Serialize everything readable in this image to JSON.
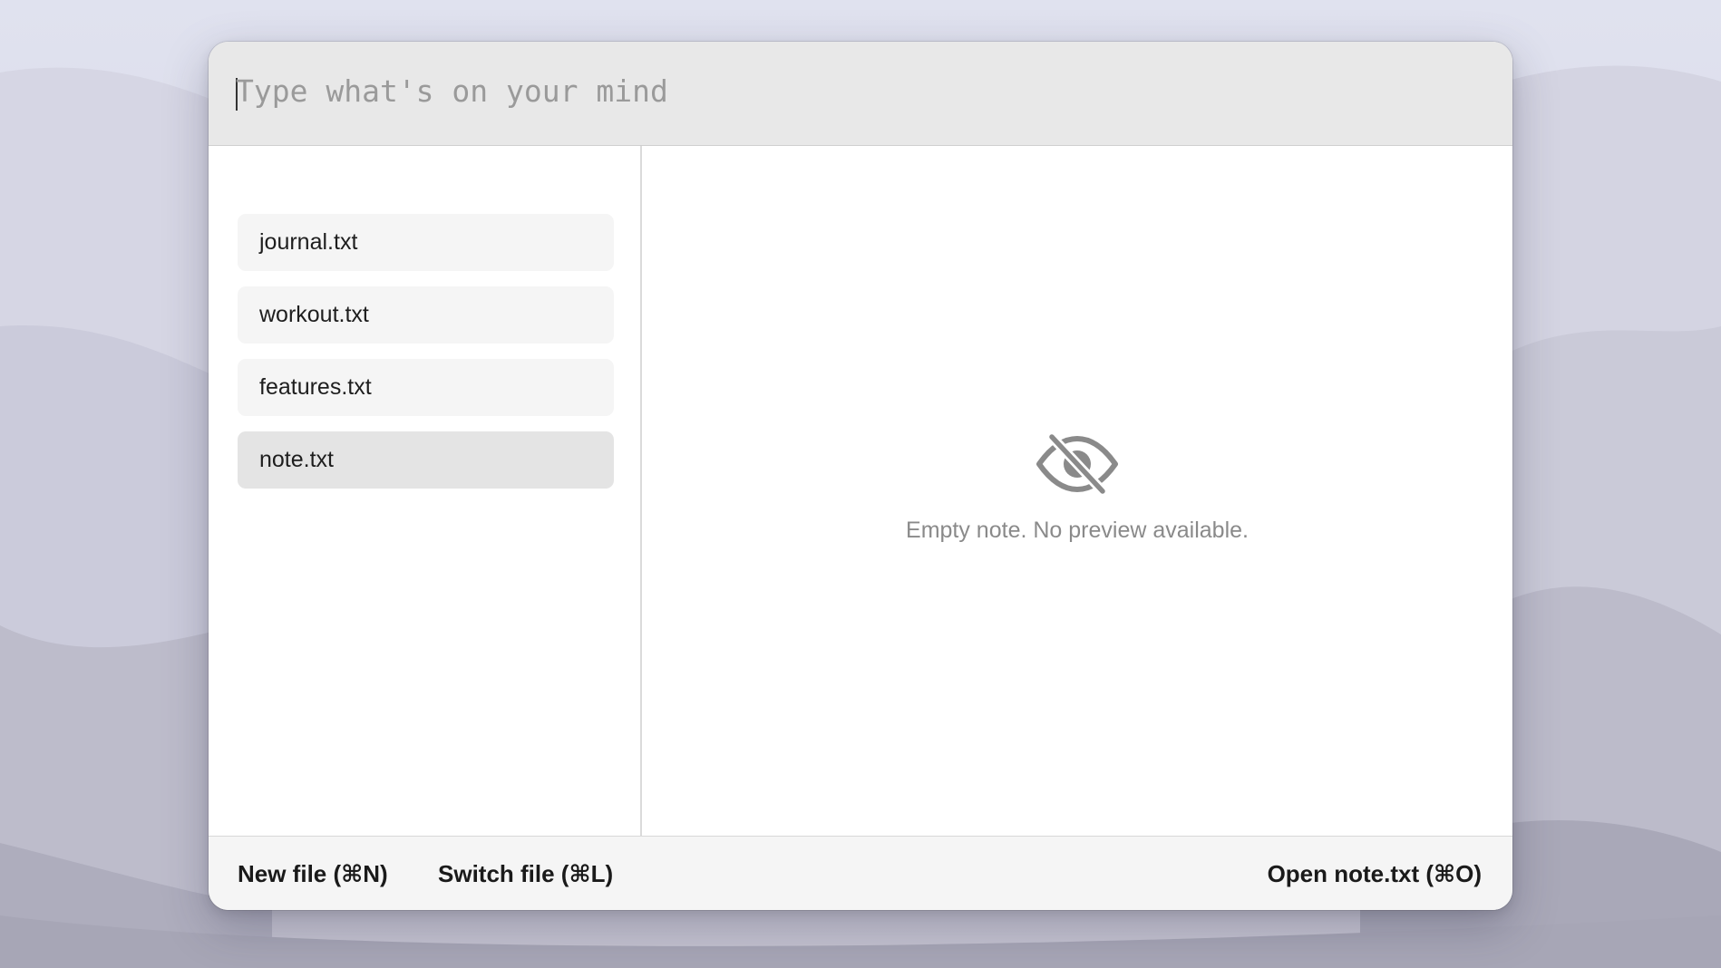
{
  "input": {
    "placeholder": "Type what's on your mind",
    "value": ""
  },
  "sidebar": {
    "items": [
      {
        "label": "journal.txt",
        "selected": false
      },
      {
        "label": "workout.txt",
        "selected": false
      },
      {
        "label": "features.txt",
        "selected": false
      },
      {
        "label": "note.txt",
        "selected": true
      }
    ]
  },
  "preview": {
    "icon": "eye-slash-icon",
    "empty_message": "Empty note. No preview available."
  },
  "footer": {
    "new_file_label": "New file (⌘N)",
    "switch_file_label": "Switch file (⌘L)",
    "open_label": "Open note.txt (⌘O)"
  },
  "colors": {
    "input_bar_bg": "#e8e8e8",
    "selected_item_bg": "#e4e4e4",
    "item_bg": "#f5f5f5",
    "footer_bg": "#f5f5f5",
    "muted_text": "#8a8a8a"
  }
}
